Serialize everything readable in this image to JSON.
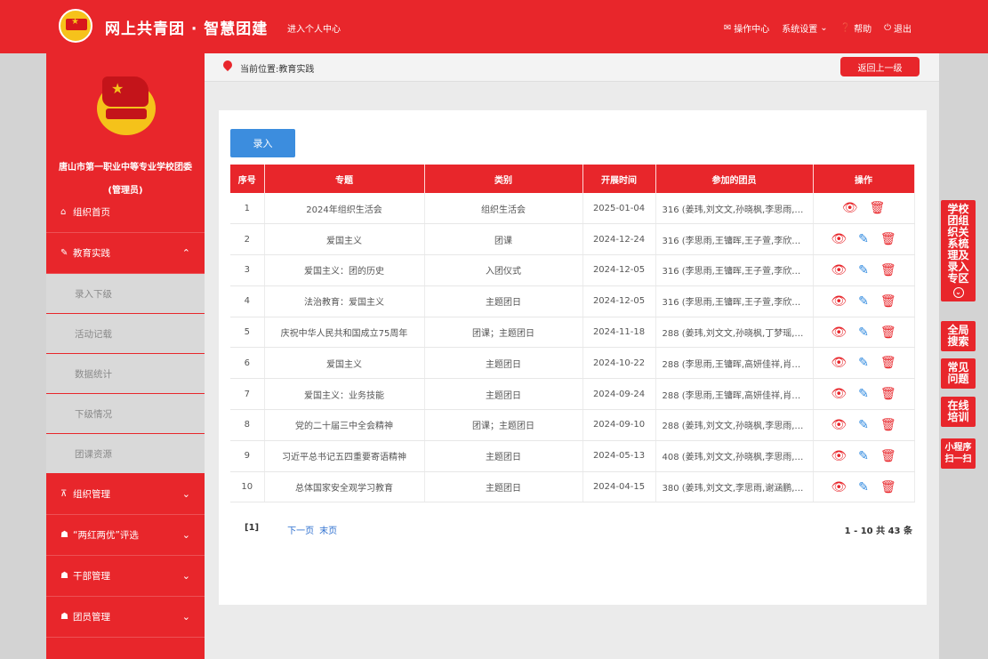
{
  "header": {
    "title": "网上共青团 · 智慧团建",
    "personal_center": "进入个人中心",
    "nav": [
      {
        "icon": "mail-icon",
        "label": "操作中心"
      },
      {
        "icon": "chevron-down-icon",
        "label": "系统设置"
      },
      {
        "icon": "question-icon",
        "label": "帮助"
      },
      {
        "icon": "power-icon",
        "label": "退出"
      }
    ]
  },
  "sidebar": {
    "org_name": "唐山市第一职业中等专业学校团委",
    "role": "(管理员)",
    "items": [
      {
        "icon": "home-icon",
        "label": "组织首页"
      },
      {
        "icon": "edit-icon",
        "label": "教育实践",
        "expanded": true
      },
      {
        "label": "录入下级"
      },
      {
        "label": "活动记载"
      },
      {
        "label": "数据统计"
      },
      {
        "label": "下级情况"
      },
      {
        "label": "团课资源"
      },
      {
        "icon": "sitemap-icon",
        "label": "组织管理"
      },
      {
        "icon": "users-icon",
        "label": "“两红两优”评选"
      },
      {
        "icon": "users-icon",
        "label": "干部管理"
      },
      {
        "icon": "users-icon",
        "label": "团员管理"
      }
    ]
  },
  "location": {
    "text": "当前位置:教育实践",
    "back_label": "返回上一级"
  },
  "toolbar": {
    "add_label": "录入"
  },
  "table": {
    "headers": [
      "序号",
      "专题",
      "类别",
      "开展时间",
      "参加的团员",
      "操作"
    ],
    "rows": [
      {
        "no": "1",
        "topic": "2024年组织生活会",
        "category": "组织生活会",
        "date": "2025-01-04",
        "members": "316 (姜玮,刘文文,孙晓枫,李思雨,…",
        "editable": false
      },
      {
        "no": "2",
        "topic": "爱国主义",
        "category": "团课",
        "date": "2024-12-24",
        "members": "316 (李思雨,王镛晖,王子萱,李欣…",
        "editable": true
      },
      {
        "no": "3",
        "topic": "爱国主义：团的历史",
        "category": "入团仪式",
        "date": "2024-12-05",
        "members": "316 (李思雨,王镛晖,王子萱,李欣…",
        "editable": true
      },
      {
        "no": "4",
        "topic": "法治教育：爱国主义",
        "category": "主题团日",
        "date": "2024-12-05",
        "members": "316 (李思雨,王镛晖,王子萱,李欣…",
        "editable": true
      },
      {
        "no": "5",
        "topic": "庆祝中华人民共和国成立75周年",
        "category": "团课；主题团日",
        "date": "2024-11-18",
        "members": "288 (姜玮,刘文文,孙晓枫,丁梦瑶,…",
        "editable": true
      },
      {
        "no": "6",
        "topic": "爱国主义",
        "category": "主题团日",
        "date": "2024-10-22",
        "members": "288 (李思雨,王镛晖,高妍佳祥,肖…",
        "editable": true
      },
      {
        "no": "7",
        "topic": "爱国主义：业务技能",
        "category": "主题团日",
        "date": "2024-09-24",
        "members": "288 (李思雨,王镛晖,高妍佳祥,肖…",
        "editable": true
      },
      {
        "no": "8",
        "topic": "党的二十届三中全会精神",
        "category": "团课；主题团日",
        "date": "2024-09-10",
        "members": "288 (姜玮,刘文文,孙晓枫,李思雨,…",
        "editable": true
      },
      {
        "no": "9",
        "topic": "习近平总书记五四重要寄语精神",
        "category": "主题团日",
        "date": "2024-05-13",
        "members": "408 (姜玮,刘文文,孙晓枫,李思雨,…",
        "editable": true
      },
      {
        "no": "10",
        "topic": "总体国家安全观学习教育",
        "category": "主题团日",
        "date": "2024-04-15",
        "members": "380 (姜玮,刘文文,李思雨,谢涵鹏,…",
        "editable": true
      }
    ]
  },
  "pager": {
    "current": "[1]",
    "next": "下一页",
    "last": "末页",
    "count": "1 - 10 共 43 条"
  },
  "float_buttons": [
    {
      "label": "学校团组织关系梳理及录入专区"
    },
    {
      "label": "全局搜索"
    },
    {
      "label": "常见问题"
    },
    {
      "label": "在线培训"
    },
    {
      "label": "小程序扫一扫"
    }
  ],
  "colors": {
    "brand_red": "#e8262b",
    "button_blue": "#3c8dde",
    "sidebar_sub_bg": "#d9d9d9"
  }
}
